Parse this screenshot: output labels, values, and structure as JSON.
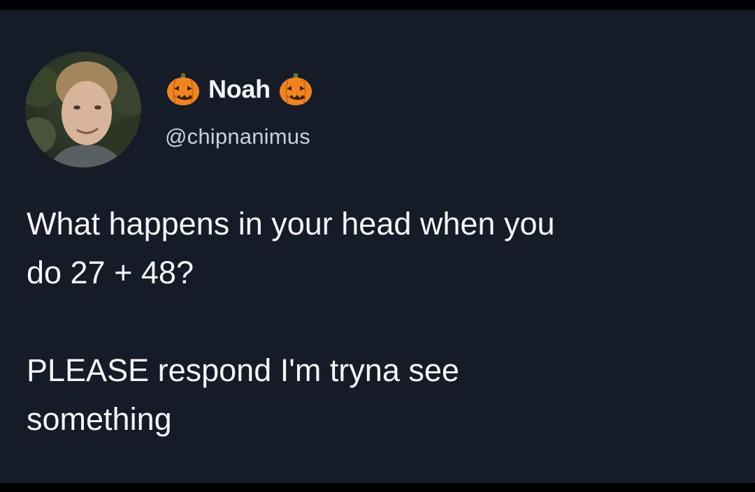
{
  "tweet": {
    "author": {
      "display_name": "Noah",
      "handle": "@chipnanimus",
      "avatar_icon": "user-avatar-photo",
      "name_emoji": "jack-o-lantern-icon"
    },
    "text_lines": [
      "What happens in your head when you",
      "do 27 + 48?",
      "",
      "PLEASE respond I'm tryna see",
      "something"
    ]
  },
  "colors": {
    "background": "#151b27",
    "text_primary": "#f5f6f8",
    "text_secondary": "#c9d1da",
    "pumpkin": "#f0841f"
  }
}
